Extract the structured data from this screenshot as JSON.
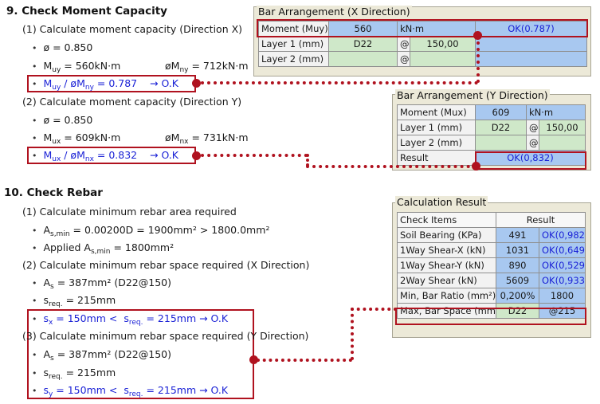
{
  "sec9": {
    "title": "9. Check Moment Capacity",
    "sub1": "(1) Calculate moment capacity (Direction X)",
    "phi1": "ø  =  0.850",
    "muy_val": "=  560kN·m",
    "phimny_val": "=  712kN·m",
    "check_x_val": "=  0.787",
    "check_x_ok": "→    O.K",
    "sub2": "(2) Calculate moment capacity (Direction Y)",
    "phi2": "ø  =  0.850",
    "mux_val": "=  609kN·m",
    "phimnx_val": "=  731kN·m",
    "check_y_val": "=  0.832",
    "check_y_ok": "→    O.K"
  },
  "sec10": {
    "title": "10. Check Rebar",
    "sub1": "(1) Calculate minimum rebar area required",
    "asmin_val": "=  0.00200D  =  1900mm²  >  1800.0mm²",
    "applied_val": "=  1800mm²",
    "sub2": "(2) Calculate minimum rebar space required (X Direction)",
    "as_x": "=  387mm²  (D22@150)",
    "sreq_x": "=  215mm",
    "sx_check": "=  150mm  <",
    "sx_check2": "=  215mm     →    O.K",
    "sub3": "(3) Calculate minimum rebar space required (Y Direction)",
    "as_y": "=  387mm²  (D22@150)",
    "sreq_y": "=  215mm",
    "sy_check": "=  150mm  <",
    "sy_check2": "=  215mm     →    O.K"
  },
  "panel_x": {
    "title": "Bar Arrangement (X Direction)",
    "rows": [
      {
        "label": "Moment (Muy)",
        "v1": "560",
        "v2": "kN·m",
        "v3": "",
        "v4": "OK(0.787)"
      },
      {
        "label": "Layer 1 (mm)",
        "v1": "D22",
        "v2": "@",
        "v3": "150,00",
        "v4": ""
      },
      {
        "label": "Layer 2 (mm)",
        "v1": "",
        "v2": "@",
        "v3": "",
        "v4": ""
      }
    ]
  },
  "panel_y": {
    "title": "Bar Arrangement (Y Direction)",
    "rows": [
      {
        "label": "Moment (Mux)",
        "v1": "609",
        "v2": "kN·m"
      },
      {
        "label": "Layer 1 (mm)",
        "v1": "D22",
        "v2": "@",
        "v3": "150,00"
      },
      {
        "label": "Layer 2 (mm)",
        "v1": "",
        "v2": "@",
        "v3": ""
      },
      {
        "label": "Result",
        "v1": "OK(0,832)"
      }
    ]
  },
  "panel_calc": {
    "title": "Calculation Result",
    "header": {
      "c1": "Check Items",
      "c2": "Result"
    },
    "rows": [
      {
        "label": "Soil Bearing (KPa)",
        "v1": "491",
        "v2": "OK(0,982)"
      },
      {
        "label": "1Way Shear-X (kN)",
        "v1": "1031",
        "v2": "OK(0,649)"
      },
      {
        "label": "1Way Shear-Y (kN)",
        "v1": "890",
        "v2": "OK(0,529)"
      },
      {
        "label": "2Way Shear (kN)",
        "v1": "5609",
        "v2": "OK(0,933)"
      },
      {
        "label": "Min, Bar Ratio (mm²)",
        "v1": "0,200%",
        "v2": "1800"
      },
      {
        "label": "Max, Bar Space (mm)",
        "v1": "D22",
        "v2": "@215"
      }
    ]
  }
}
